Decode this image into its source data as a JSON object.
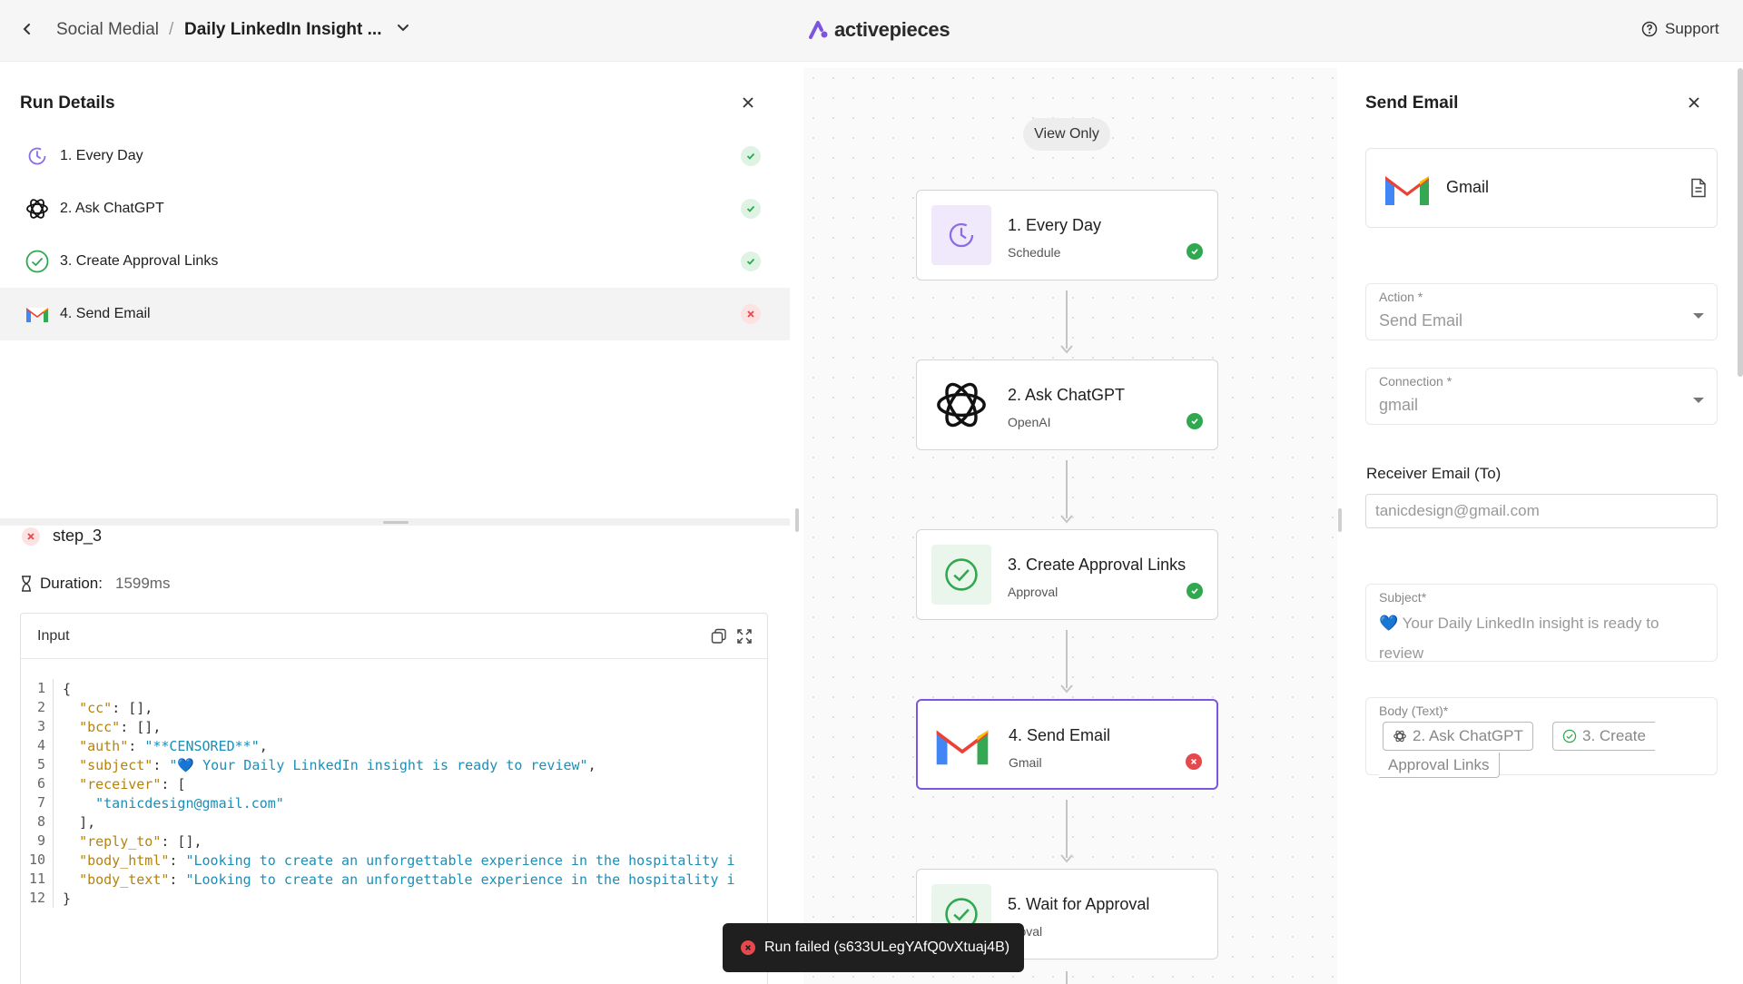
{
  "header": {
    "breadcrumb_parent": "Social Medial",
    "breadcrumb_sep": "/",
    "breadcrumb_current": "Daily LinkedIn Insight ...",
    "logo_text": "activepieces",
    "support_label": "Support"
  },
  "run_details": {
    "title": "Run Details",
    "steps": [
      {
        "label": "1. Every Day",
        "status": "success"
      },
      {
        "label": "2. Ask ChatGPT",
        "status": "success"
      },
      {
        "label": "3. Create Approval Links",
        "status": "success"
      },
      {
        "label": "4. Send Email",
        "status": "failed"
      }
    ],
    "step_name": "step_3",
    "duration_label": "Duration:",
    "duration_value": "1599ms",
    "input_title": "Input",
    "code_lines": [
      "1",
      "2",
      "3",
      "4",
      "5",
      "6",
      "7",
      "8",
      "9",
      "10",
      "11",
      "12"
    ],
    "code": {
      "l1": "{",
      "cc_key": "\"cc\"",
      "cc_val": ": [],",
      "bcc_key": "\"bcc\"",
      "bcc_val": ": [],",
      "auth_key": "\"auth\"",
      "auth_val": "\"**CENSORED**\"",
      "subject_key": "\"subject\"",
      "subject_val": "\"💙 Your Daily LinkedIn insight is ready to review\"",
      "receiver_key": "\"receiver\"",
      "receiver_open": ": [",
      "receiver_item": "\"tanicdesign@gmail.com\"",
      "receiver_close": "],",
      "reply_key": "\"reply_to\"",
      "reply_val": ": [],",
      "body_html_key": "\"body_html\"",
      "body_html_val": "\"Looking to create an unforgettable experience in the hospitality i",
      "body_text_key": "\"body_text\"",
      "body_text_val": "\"Looking to create an unforgettable experience in the hospitality i",
      "l12": "}"
    }
  },
  "canvas": {
    "view_only": "View Only",
    "nodes": [
      {
        "title": "1. Every Day",
        "subtitle": "Schedule",
        "status": "success"
      },
      {
        "title": "2. Ask ChatGPT",
        "subtitle": "OpenAI",
        "status": "success"
      },
      {
        "title": "3. Create Approval Links",
        "subtitle": "Approval",
        "status": "success"
      },
      {
        "title": "4. Send Email",
        "subtitle": "Gmail",
        "status": "failed"
      },
      {
        "title": "5. Wait for Approval",
        "subtitle": "proval",
        "status": "pending"
      }
    ]
  },
  "toast": {
    "message": "Run failed (s633ULegYAfQ0vXtuaj4B)"
  },
  "send_email": {
    "title": "Send Email",
    "piece_name": "Gmail",
    "action_label": "Action *",
    "action_value": "Send Email",
    "connection_label": "Connection *",
    "connection_value": "gmail",
    "receiver_label": "Receiver Email (To)",
    "receiver_value": "tanicdesign@gmail.com",
    "subject_label": "Subject*",
    "subject_value": "💙 Your Daily LinkedIn insight is ready to review",
    "body_label": "Body (Text)*",
    "body_chip_1": "2. Ask ChatGPT",
    "body_chip_2a": "3. Create",
    "body_chip_2b": "Approval Links"
  },
  "colors": {
    "accent": "#7d55e0",
    "success": "#2fa84f",
    "error": "#e5484d"
  }
}
